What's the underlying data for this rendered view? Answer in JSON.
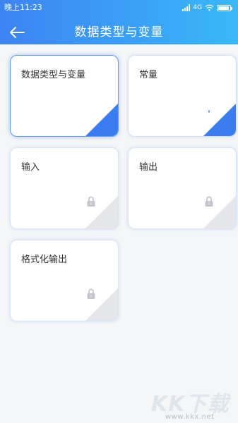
{
  "status_bar": {
    "time": "晚上11:23",
    "network": "4G"
  },
  "header": {
    "title": "数据类型与变量",
    "back_icon": "arrow-left-icon"
  },
  "cards": [
    {
      "label": "数据类型与变量",
      "state": "completed",
      "icon": "check-icon",
      "accent": "#3b7cf0"
    },
    {
      "label": "常量",
      "state": "unlocked",
      "icon": "unlock-icon",
      "accent": "#3b7cf0"
    },
    {
      "label": "输入",
      "state": "locked",
      "icon": "lock-icon",
      "accent": "#e4e6ea"
    },
    {
      "label": "输出",
      "state": "locked",
      "icon": "lock-icon",
      "accent": "#e4e6ea"
    },
    {
      "label": "格式化输出",
      "state": "locked",
      "icon": "lock-icon",
      "accent": "#e4e6ea"
    }
  ],
  "watermark": {
    "logo_text": "KK下载",
    "url": "www.kkx.net"
  }
}
